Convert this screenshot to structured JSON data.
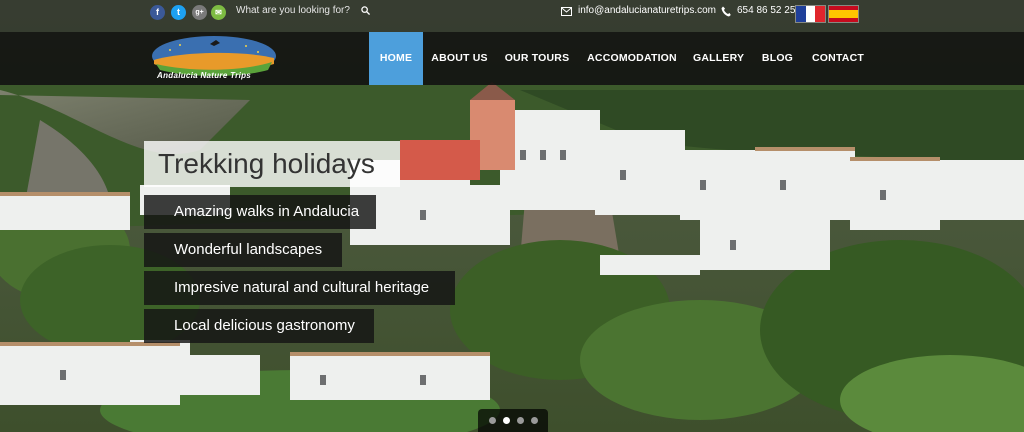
{
  "topbar": {
    "social": [
      {
        "name": "facebook-icon",
        "glyph": "f",
        "color": "#3b5998"
      },
      {
        "name": "twitter-icon",
        "glyph": "t",
        "color": "#1da1f2"
      },
      {
        "name": "google-plus-icon",
        "glyph": "g+",
        "color": "#7a7a7a"
      },
      {
        "name": "email-share-icon",
        "glyph": "✉",
        "color": "#7dbb42"
      }
    ],
    "search_placeholder": "What are you looking for?",
    "email": "info@andalucianaturetrips.com",
    "phone": "654 86 52 25",
    "languages": [
      "french-flag",
      "spanish-flag"
    ]
  },
  "brand": {
    "logo_text": "Andalucia Nature Trips"
  },
  "nav": {
    "items": [
      "HOME",
      "ABOUT US",
      "OUR TOURS",
      "ACCOMODATION",
      "GALLERY",
      "BLOG",
      "CONTACT"
    ],
    "active": "HOME",
    "accent": "#4d9fdc"
  },
  "hero": {
    "title": "Trekking holidays",
    "lines": [
      "Amazing walks in Andalucia",
      "Wonderful landscapes",
      "Impresive natural and cultural heritage",
      "Local delicious gastronomy"
    ],
    "slides_total": 4,
    "slide_active": 2
  }
}
